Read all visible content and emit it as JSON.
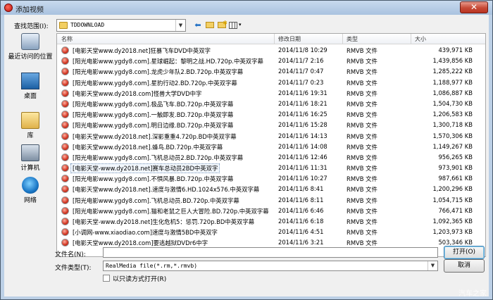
{
  "window": {
    "title": "添加视频",
    "close_glyph": "✕"
  },
  "lookin": {
    "label": "查找范围(I):",
    "value": "TDDOWNLOAD"
  },
  "toolbar": {
    "back_glyph": "⬅",
    "new_glyph": "✱",
    "view_glyph": "▾"
  },
  "places": [
    {
      "label": "最近访问的位置",
      "icon": "recent-places-icon"
    },
    {
      "label": "桌面",
      "icon": "desktop-icon"
    },
    {
      "label": "库",
      "icon": "library-icon"
    },
    {
      "label": "计算机",
      "icon": "computer-icon"
    },
    {
      "label": "网络",
      "icon": "network-icon"
    }
  ],
  "columns": {
    "name": "名称",
    "date": "修改日期",
    "type": "类型",
    "size": "大小"
  },
  "files": [
    {
      "name": "[电影天堂www.dy2018.net]狂暴飞车DVD中英双字",
      "date": "2014/11/8 10:29",
      "type": "RMVB 文件",
      "size": "439,971 KB"
    },
    {
      "name": "[阳光电影www.ygdy8.com].星球崛起：黎明之战.HD.720p.中英双字幕",
      "date": "2014/11/7 2:16",
      "type": "RMVB 文件",
      "size": "1,439,856 KB"
    },
    {
      "name": "[阳光电影www.ygdy8.com].龙虎少年队2.BD.720p.中英双字幕",
      "date": "2014/11/7 0:47",
      "type": "RMVB 文件",
      "size": "1,285,222 KB"
    },
    {
      "name": "[阳光电影www.ygdy8.com].星豹行动2.BD.720p.中英双字幕",
      "date": "2014/11/7 0:23",
      "type": "RMVB 文件",
      "size": "1,188,977 KB"
    },
    {
      "name": "[电影天堂www.dy2018.com]怪兽大学DVD中字",
      "date": "2014/11/6 19:31",
      "type": "RMVB 文件",
      "size": "1,086,887 KB"
    },
    {
      "name": "[阳光电影www.ygdy8.com].极品飞车.BD.720p.中英双字幕",
      "date": "2014/11/6 18:21",
      "type": "RMVB 文件",
      "size": "1,504,730 KB"
    },
    {
      "name": "[阳光电影www.ygdy8.com].一触即发.BD.720p.中英双字幕",
      "date": "2014/11/6 16:25",
      "type": "RMVB 文件",
      "size": "1,206,583 KB"
    },
    {
      "name": "[阳光电影www.ygdy8.com].明日边缘.BD.720p.中英双字幕",
      "date": "2014/11/6 15:28",
      "type": "RMVB 文件",
      "size": "1,300,718 KB"
    },
    {
      "name": "[电影天堂www.dy2018.net].深影重重4.720p.BD中英双字幕",
      "date": "2014/11/6 14:13",
      "type": "RMVB 文件",
      "size": "1,570,306 KB"
    },
    {
      "name": "[电影天堂www.dy2018.net].蜂鸟.BD.720p.中英双字幕",
      "date": "2014/11/6 14:08",
      "type": "RMVB 文件",
      "size": "1,149,267 KB"
    },
    {
      "name": "[阳光电影www.ygdy8.com].飞机总动员2.BD.720p.中英双字幕",
      "date": "2014/11/6 12:46",
      "type": "RMVB 文件",
      "size": "956,265 KB"
    },
    {
      "name": "[电影天堂-www.dy2018.net]赛车总动员2BD中英双字",
      "date": "2014/11/6 11:31",
      "type": "RMVB 文件",
      "size": "973,901 KB",
      "selected": true
    },
    {
      "name": "[阳光电影www.ygdy8.com].不惧风暴.BD.720p.中英双字幕",
      "date": "2014/11/6 10:27",
      "type": "RMVB 文件",
      "size": "987,661 KB"
    },
    {
      "name": "[电影天堂www.dy2018.net].速度与激情6.HD.1024x576.中英双字幕",
      "date": "2014/11/6 8:41",
      "type": "RMVB 文件",
      "size": "1,200,296 KB"
    },
    {
      "name": "[阳光电影www.ygdy8.com].飞机总动员.BD.720p.中英双字幕",
      "date": "2014/11/6 8:11",
      "type": "RMVB 文件",
      "size": "1,054,715 KB"
    },
    {
      "name": "[阳光电影www.ygdy8.com].猫和老鼠之巨人大冒险.BD.720p.中英双字幕",
      "date": "2014/11/6 6:46",
      "type": "RMVB 文件",
      "size": "766,471 KB"
    },
    {
      "name": "[电影天堂-www.dy2018.net]生化危机5：惩罚.720p.BD中英双字幕",
      "date": "2014/11/6 6:18",
      "type": "RMVB 文件",
      "size": "1,092,365 KB"
    },
    {
      "name": "[小调网-www.xiaodiao.com]速度与激情5BD中英双字",
      "date": "2014/11/6 4:51",
      "type": "RMVB 文件",
      "size": "1,203,973 KB"
    },
    {
      "name": "[电影天堂www.dy2018.com]要逃越狱DVDr6中字",
      "date": "2014/11/6 3:21",
      "type": "RMVB 文件",
      "size": "503,346 KB"
    }
  ],
  "filename": {
    "label": "文件名(N):",
    "value": ""
  },
  "filetype": {
    "label": "文件类型(T):",
    "value": "RealMedia file(*.rm,*.rmvb)"
  },
  "readonly": {
    "label": "以只读方式打开(R)"
  },
  "buttons": {
    "open": "打开(O)",
    "cancel": "取消"
  },
  "watermark": "汽车之家"
}
